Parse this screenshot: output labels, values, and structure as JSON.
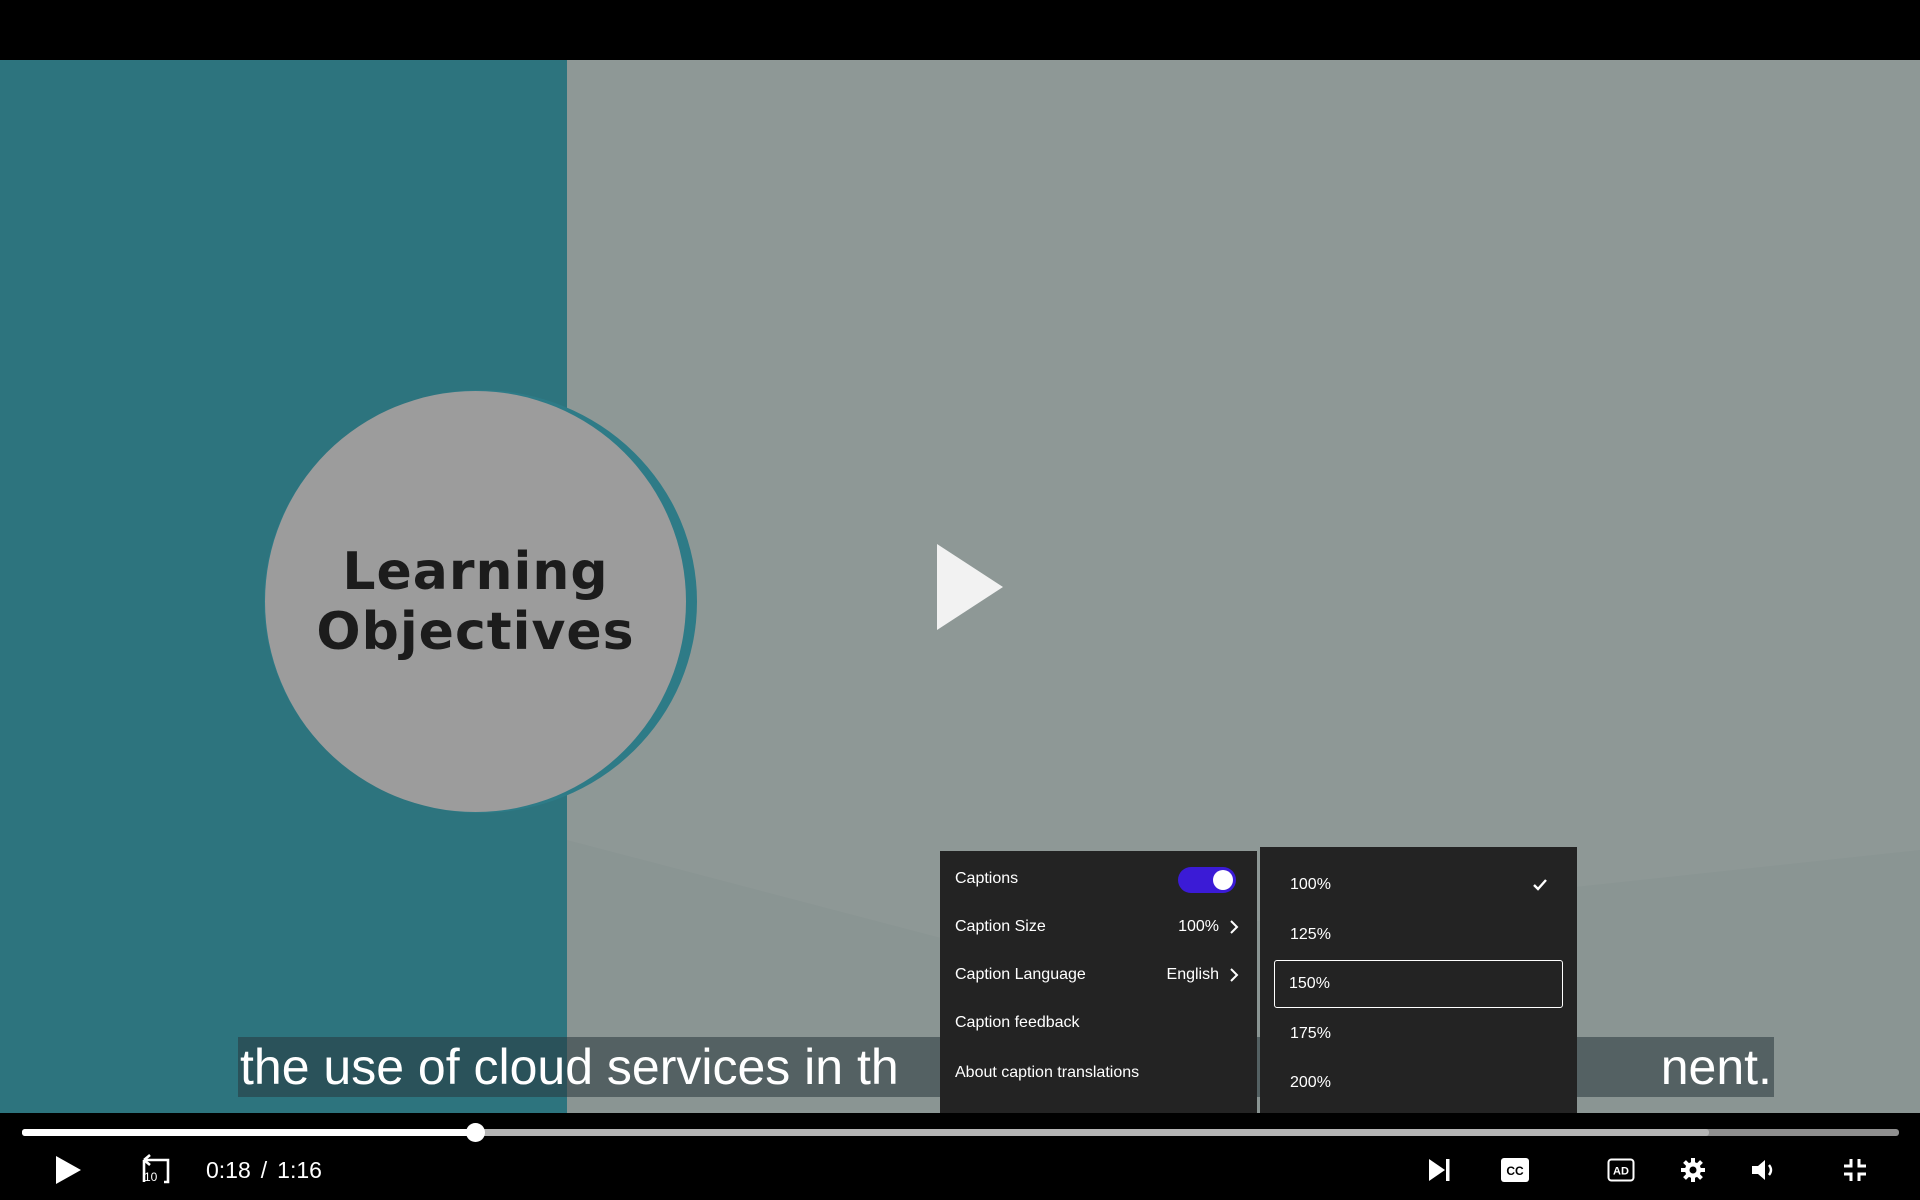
{
  "slide": {
    "title": "Learning\nObjectives"
  },
  "subtitle": {
    "left_text": "the use of cloud services in th",
    "right_text": "nent."
  },
  "caption_menu": {
    "captions_label": "Captions",
    "captions_on": true,
    "caption_size_label": "Caption Size",
    "caption_size_value": "100%",
    "caption_language_label": "Caption Language",
    "caption_language_value": "English",
    "caption_feedback_label": "Caption feedback",
    "about_translations_label": "About caption translations"
  },
  "size_submenu": {
    "options": [
      "100%",
      "125%",
      "150%",
      "175%",
      "200%"
    ],
    "checked": "100%",
    "focused": "150%"
  },
  "player": {
    "current_time": "0:18",
    "separator": "/",
    "duration": "1:16",
    "progress_fraction": 0.24,
    "buffered_fraction": 0.9,
    "rewind_seconds": "10"
  },
  "colors": {
    "toggle_on": "#3b1bd6",
    "slide_teal": "#2d747e",
    "slide_grey": "#8e9896",
    "menu_bg": "#232323"
  },
  "icons": [
    "play-icon",
    "rewind-10-icon",
    "next-icon",
    "closed-captions-icon",
    "audio-description-icon",
    "settings-icon",
    "volume-icon",
    "exit-fullscreen-icon",
    "chevron-right-icon",
    "check-icon"
  ]
}
